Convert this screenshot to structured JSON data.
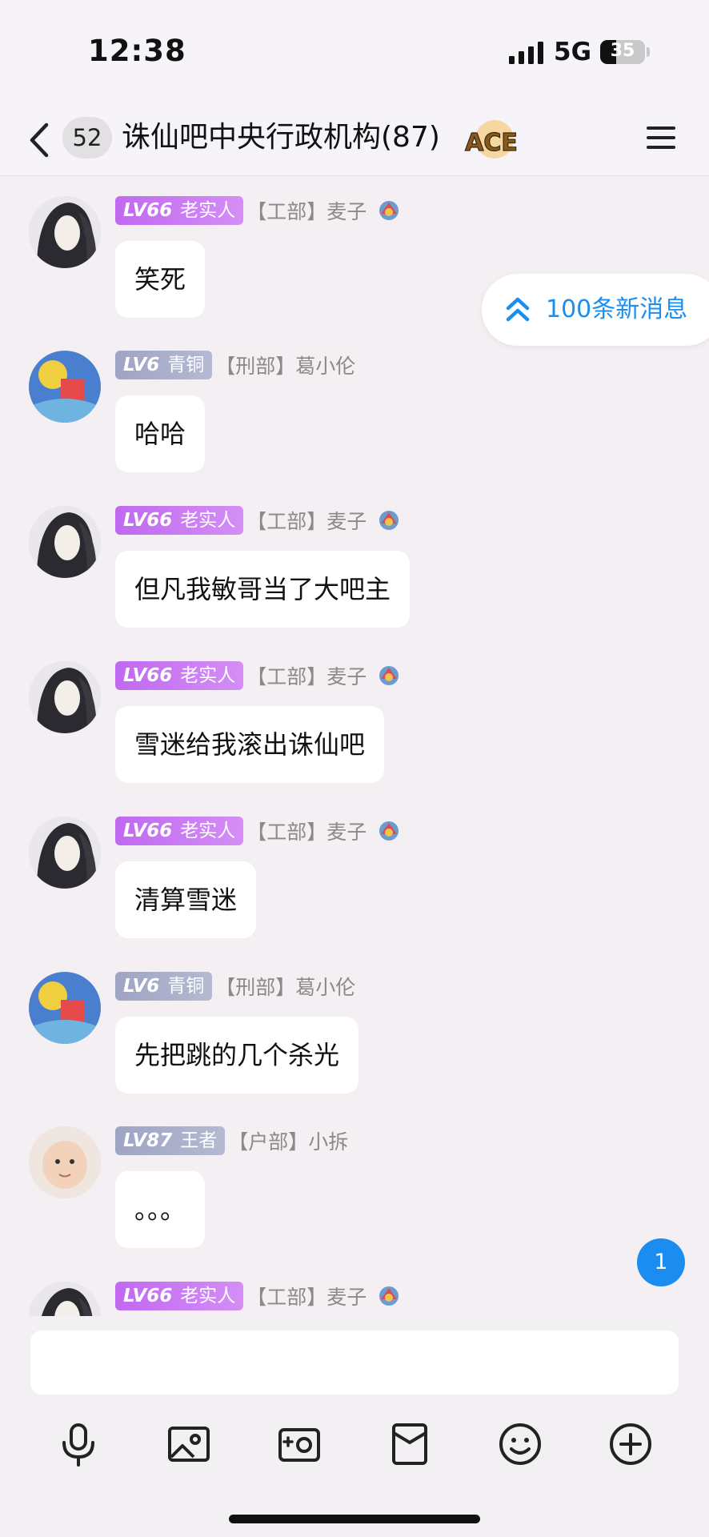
{
  "status": {
    "time": "12:38",
    "network": "5G",
    "battery": "35"
  },
  "header": {
    "unread_count": "52",
    "title": "诛仙吧中央行政机构(87)",
    "badge_text": "ACE"
  },
  "new_messages_label": "100条新消息",
  "unread_bubble": "1",
  "messages": [
    {
      "level": "LV66",
      "rank": "老实人",
      "dept": "【工部】麦子",
      "text": "笑死"
    },
    {
      "level": "LV6",
      "rank": "青铜",
      "dept": "【刑部】葛小伦",
      "text": "哈哈"
    },
    {
      "level": "LV66",
      "rank": "老实人",
      "dept": "【工部】麦子",
      "text": "但凡我敏哥当了大吧主"
    },
    {
      "level": "LV66",
      "rank": "老实人",
      "dept": "【工部】麦子",
      "text": "雪迷给我滚出诛仙吧"
    },
    {
      "level": "LV66",
      "rank": "老实人",
      "dept": "【工部】麦子",
      "text": "清算雪迷"
    },
    {
      "level": "LV6",
      "rank": "青铜",
      "dept": "【刑部】葛小伦",
      "text": "先把跳的几个杀光"
    },
    {
      "level": "LV87",
      "rank": "王者",
      "dept": "【户部】小拆",
      "text": "。。。"
    },
    {
      "level": "LV66",
      "rank": "老实人",
      "dept": "【工部】麦子",
      "text": ""
    }
  ],
  "colors": {
    "accent": "#1a8ff0",
    "level_purple": "#c069f1",
    "level_gray": "#9ea4c3"
  },
  "toolbar_icons": [
    "microphone-icon",
    "image-icon",
    "camera-icon",
    "red-packet-icon",
    "emoji-icon",
    "plus-icon"
  ]
}
